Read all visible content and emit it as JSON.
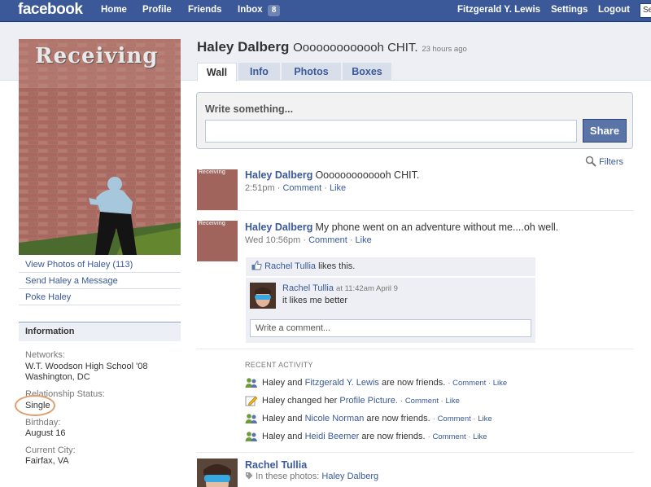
{
  "topbar": {
    "logo": "facebook",
    "nav": [
      "Home",
      "Profile",
      "Friends"
    ],
    "inbox_label": "Inbox",
    "inbox_count": "8",
    "user_name": "Fitzgerald Y. Lewis",
    "settings": "Settings",
    "logout": "Logout",
    "search_value": "Se"
  },
  "profile": {
    "name": "Haley Dalberg",
    "status": "Ooooooooooooh CHIT.",
    "status_time": "23 hours ago",
    "picture_text": "Receiving"
  },
  "tabs": [
    "Wall",
    "Info",
    "Photos",
    "Boxes"
  ],
  "left_links": [
    "View Photos of Haley (113)",
    "Send Haley a Message",
    "Poke Haley"
  ],
  "info": {
    "heading": "Information",
    "networks_label": "Networks:",
    "networks_value_1": "W.T. Woodson High School '08",
    "networks_value_2": "Washington, DC",
    "relationship_label": "Relationship Status:",
    "relationship_value": "Single",
    "birthday_label": "Birthday:",
    "birthday_value": "August 16",
    "city_label": "Current City:",
    "city_value": "Fairfax, VA"
  },
  "publisher": {
    "prompt": "Write something...",
    "share": "Share"
  },
  "filters": "Filters",
  "stories": [
    {
      "name": "Haley Dalberg",
      "text": "Ooooooooooooh CHIT.",
      "time": "2:51pm",
      "comment": "Comment",
      "like": "Like"
    },
    {
      "name": "Haley Dalberg",
      "text": "My phone went on an adventure without me....oh well.",
      "time": "Wed 10:56pm",
      "comment": "Comment",
      "like": "Like",
      "liked_by": "Rachel Tullia",
      "likes_text": "likes this.",
      "comment_author": "Rachel Tullia",
      "comment_time": "at 11:42am April 9",
      "comment_text": "it likes me better",
      "write_comment": "Write a comment..."
    }
  ],
  "recent_activity": {
    "heading": "RECENT ACTIVITY",
    "items": [
      {
        "pre": "Haley and",
        "link": "Fitzgerald Y. Lewis",
        "post": "are now friends."
      },
      {
        "pre": "Haley changed her",
        "link": "Profile Picture.",
        "post": ""
      },
      {
        "pre": "Haley and",
        "link": "Nicole Norman",
        "post": "are now friends."
      },
      {
        "pre": "Haley and",
        "link": "Heidi Beemer",
        "post": "are now friends."
      }
    ],
    "comment": "Comment",
    "like": "Like"
  },
  "photo_story": {
    "name": "Rachel Tullia",
    "in_photos": "In these photos:",
    "tagged": "Haley Dalberg"
  }
}
